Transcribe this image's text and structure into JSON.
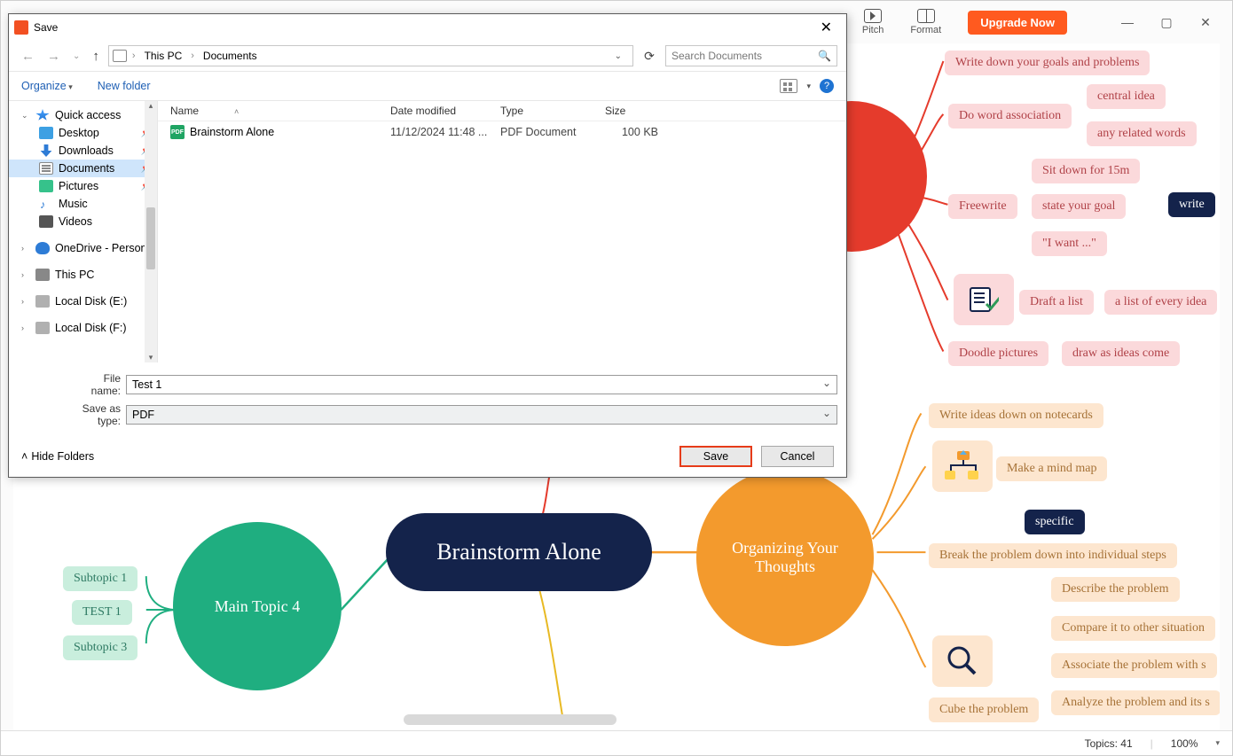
{
  "app": {
    "topbar": {
      "pitch": "Pitch",
      "format": "Format",
      "upgrade": "Upgrade Now"
    },
    "status": {
      "topics_label": "Topics:",
      "topics_count": 41,
      "zoom": "100%"
    }
  },
  "mindmap": {
    "central": "Brainstorm Alone",
    "main4": "Main Topic 4",
    "subtopic1": "Subtopic 1",
    "test1": "TEST 1",
    "subtopic3": "Subtopic 3",
    "organizing": "Organizing Your Thoughts",
    "write_goals": "Write down your goals and problems",
    "word_assoc": "Do word association",
    "central_idea": "central idea",
    "related_words": "any related words",
    "freewrite": "Freewrite",
    "sit15": "Sit down for 15m",
    "state_goal": "state your goal",
    "i_want": "\"I want ...\"",
    "write_tag": "write",
    "draft_list": "Draft a list",
    "list_every": "a list of every idea",
    "doodle": "Doodle pictures",
    "draw_ideas": "draw as ideas come",
    "notecards": "Write ideas down on notecards",
    "mind_map": "Make a mind map",
    "specific": "specific",
    "break_problem": "Break the problem down into individual steps",
    "cube": "Cube the problem",
    "describe": "Describe the problem",
    "compare": "Compare it to other situation",
    "associate": "Associate the problem with s",
    "analyze": "Analyze the problem and its s"
  },
  "dialog": {
    "title": "Save",
    "breadcrumb": {
      "root": "This PC",
      "folder": "Documents"
    },
    "search_placeholder": "Search Documents",
    "toolbar": {
      "organize": "Organize",
      "newfolder": "New folder"
    },
    "columns": {
      "name": "Name",
      "date": "Date modified",
      "type": "Type",
      "size": "Size"
    },
    "tree": {
      "quick": "Quick access",
      "desktop": "Desktop",
      "downloads": "Downloads",
      "documents": "Documents",
      "pictures": "Pictures",
      "music": "Music",
      "videos": "Videos",
      "onedrive": "OneDrive - Person",
      "thispc": "This PC",
      "diske": "Local Disk (E:)",
      "diskf": "Local Disk (F:)"
    },
    "file": {
      "name": "Brainstorm Alone",
      "date": "11/12/2024 11:48 ...",
      "type": "PDF Document",
      "size": "100 KB"
    },
    "fields": {
      "filename_label": "File name:",
      "filename_value": "Test 1",
      "savetype_label": "Save as type:",
      "savetype_value": "PDF"
    },
    "footer": {
      "hide": "Hide Folders",
      "save": "Save",
      "cancel": "Cancel"
    }
  }
}
